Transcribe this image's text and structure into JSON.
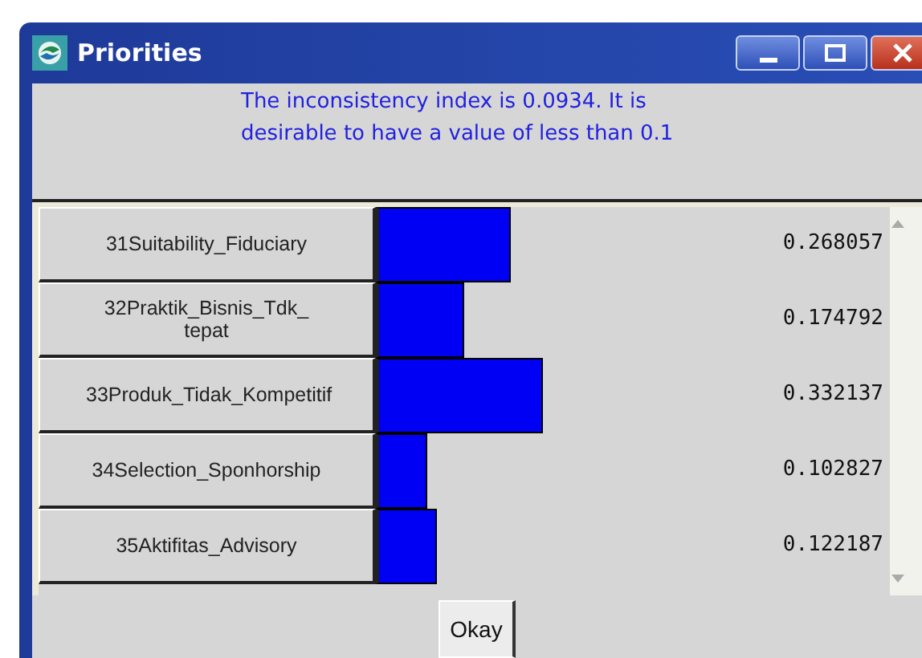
{
  "window": {
    "title": "Priorities"
  },
  "message": "The inconsistency index is 0.0934.  It is desirable to have a value of less than 0.1",
  "priorities": [
    {
      "label": "31Suitability_Fiduciary",
      "value": "0.268057"
    },
    {
      "label": "32Praktik_Bisnis_Tdk_ tepat",
      "value": "0.174792"
    },
    {
      "label": "33Produk_Tidak_Kompetitif",
      "value": "0.332137"
    },
    {
      "label": "34Selection_Sponhorship",
      "value": "0.102827"
    },
    {
      "label": "35Aktifitas_Advisory",
      "value": "0.122187"
    }
  ],
  "buttons": [
    "Okay"
  ]
}
